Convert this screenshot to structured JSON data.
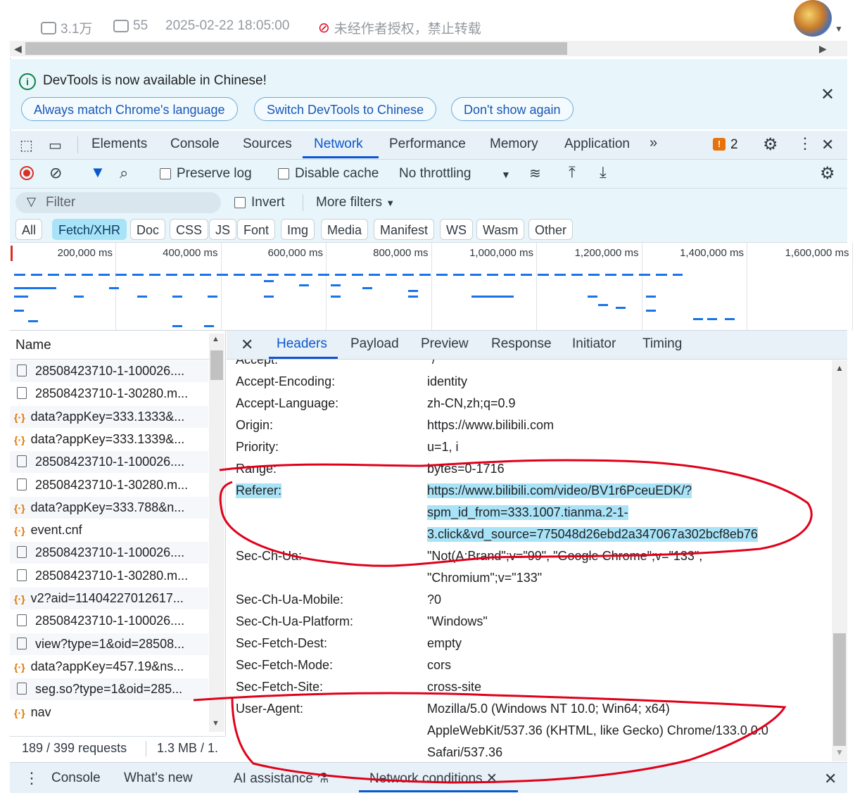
{
  "page": {
    "views": "3.1万",
    "comments": "55",
    "datetime": "2025-02-22 18:05:00",
    "copyright": "未经作者授权，禁止转载"
  },
  "banner": {
    "message": "DevTools is now available in Chinese!",
    "buttons": [
      "Always match Chrome's language",
      "Switch DevTools to Chinese",
      "Don't show again"
    ]
  },
  "tabs": [
    "Elements",
    "Console",
    "Sources",
    "Network",
    "Performance",
    "Memory",
    "Application"
  ],
  "active_tab": "Network",
  "issues_count": "2",
  "toolbar": {
    "preserve_log": "Preserve log",
    "disable_cache": "Disable cache",
    "throttling": "No throttling"
  },
  "filter": {
    "placeholder": "Filter",
    "invert": "Invert",
    "more_filters": "More filters"
  },
  "type_filters": [
    "All",
    "Fetch/XHR",
    "Doc",
    "CSS",
    "JS",
    "Font",
    "Img",
    "Media",
    "Manifest",
    "WS",
    "Wasm",
    "Other"
  ],
  "active_type": "Fetch/XHR",
  "timeline_ticks": [
    "200,000 ms",
    "400,000 ms",
    "600,000 ms",
    "800,000 ms",
    "1,000,000 ms",
    "1,200,000 ms",
    "1,400,000 ms",
    "1,600,000 ms"
  ],
  "list": {
    "header": "Name",
    "rows": [
      {
        "name": "28508423710-1-100026....",
        "kind": "doc"
      },
      {
        "name": "28508423710-1-30280.m...",
        "kind": "doc"
      },
      {
        "name": "data?appKey=333.1333&...",
        "kind": "xhr"
      },
      {
        "name": "data?appKey=333.1339&...",
        "kind": "xhr"
      },
      {
        "name": "28508423710-1-100026....",
        "kind": "doc"
      },
      {
        "name": "28508423710-1-30280.m...",
        "kind": "doc"
      },
      {
        "name": "data?appKey=333.788&n...",
        "kind": "xhr"
      },
      {
        "name": "event.cnf",
        "kind": "xhr"
      },
      {
        "name": "28508423710-1-100026....",
        "kind": "doc"
      },
      {
        "name": "28508423710-1-30280.m...",
        "kind": "doc"
      },
      {
        "name": "v2?aid=11404227012617...",
        "kind": "xhr"
      },
      {
        "name": "28508423710-1-100026....",
        "kind": "doc"
      },
      {
        "name": "view?type=1&oid=28508...",
        "kind": "doc"
      },
      {
        "name": "data?appKey=457.19&ns...",
        "kind": "xhr"
      },
      {
        "name": "seg.so?type=1&oid=285...",
        "kind": "doc"
      },
      {
        "name": "nav",
        "kind": "xhr"
      }
    ],
    "requests": "189 / 399 requests",
    "transferred": "1.3 MB / 1."
  },
  "detail_tabs": [
    "Headers",
    "Payload",
    "Preview",
    "Response",
    "Initiator",
    "Timing"
  ],
  "active_detail_tab": "Headers",
  "headers": [
    {
      "name": "Accept:",
      "value": [
        "*/*"
      ]
    },
    {
      "name": "Accept-Encoding:",
      "value": [
        "identity"
      ]
    },
    {
      "name": "Accept-Language:",
      "value": [
        "zh-CN,zh;q=0.9"
      ]
    },
    {
      "name": "Origin:",
      "value": [
        "https://www.bilibili.com"
      ]
    },
    {
      "name": "Priority:",
      "value": [
        "u=1, i"
      ]
    },
    {
      "name": "Range:",
      "value": [
        "bytes=0-1716"
      ]
    },
    {
      "name": "Referer:",
      "value": [
        "https://www.bilibili.com/video/BV1r6PceuEDK/?",
        "spm_id_from=333.1007.tianma.2-1-",
        "3.click&vd_source=775048d26ebd2a347067a302bcf8eb76"
      ],
      "highlight": true
    },
    {
      "name": "Sec-Ch-Ua:",
      "value": [
        "\"Not(A:Brand\";v=\"99\", \"Google Chrome\";v=\"133\",",
        "\"Chromium\";v=\"133\""
      ]
    },
    {
      "name": "Sec-Ch-Ua-Mobile:",
      "value": [
        "?0"
      ]
    },
    {
      "name": "Sec-Ch-Ua-Platform:",
      "value": [
        "\"Windows\""
      ]
    },
    {
      "name": "Sec-Fetch-Dest:",
      "value": [
        "empty"
      ]
    },
    {
      "name": "Sec-Fetch-Mode:",
      "value": [
        "cors"
      ]
    },
    {
      "name": "Sec-Fetch-Site:",
      "value": [
        "cross-site"
      ]
    },
    {
      "name": "User-Agent:",
      "value": [
        "Mozilla/5.0 (Windows NT 10.0; Win64; x64)",
        "AppleWebKit/537.36 (KHTML, like Gecko) Chrome/133.0.0.0",
        "Safari/537.36"
      ]
    }
  ],
  "drawer": {
    "tabs": [
      "Console",
      "What's new",
      "AI assistance",
      "Network conditions"
    ]
  },
  "colors": {
    "accent": "#0b57d0",
    "annotation": "#e0001a",
    "highlight": "#a9e3f7"
  }
}
